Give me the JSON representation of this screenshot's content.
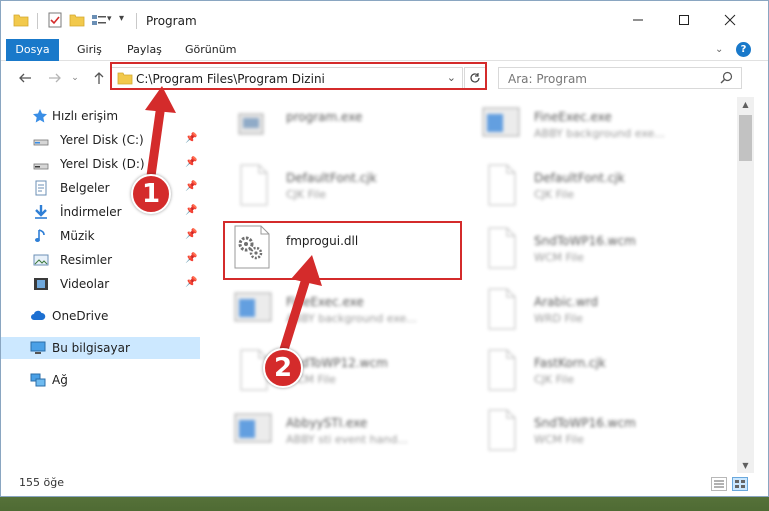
{
  "window": {
    "title": "Program",
    "controls": [
      "minimize",
      "maximize",
      "close"
    ]
  },
  "ribbon": {
    "tabs": [
      "Dosya",
      "Giriş",
      "Paylaş",
      "Görünüm"
    ],
    "accent": "#1979ca"
  },
  "address": {
    "path": "C:\\Program Files\\Program Dizini",
    "search_placeholder": "Ara: Program"
  },
  "sidebar": {
    "quick_access": "Hızlı erişim",
    "items": [
      {
        "label": "Yerel Disk (C:)",
        "icon": "drive-icon",
        "pinned": true
      },
      {
        "label": "Yerel Disk (D:)",
        "icon": "drive-icon",
        "pinned": true
      },
      {
        "label": "Belgeler",
        "icon": "documents-icon",
        "pinned": true
      },
      {
        "label": "İndirmeler",
        "icon": "downloads-icon",
        "pinned": true
      },
      {
        "label": "Müzik",
        "icon": "music-icon",
        "pinned": true
      },
      {
        "label": "Resimler",
        "icon": "pictures-icon",
        "pinned": true
      },
      {
        "label": "Videolar",
        "icon": "videos-icon",
        "pinned": true
      }
    ],
    "onedrive": "OneDrive",
    "this_pc": "Bu bilgisayar",
    "network": "Ağ"
  },
  "files": [
    {
      "name": "program.exe",
      "desc": "",
      "icon": "exe-icon",
      "blurred": true
    },
    {
      "name": "FineExec.exe",
      "desc": "ABBY background exe...",
      "icon": "app-window-icon",
      "blurred": true
    },
    {
      "name": "DefaultFont.cjk",
      "desc": "CJK File",
      "icon": "file-icon",
      "blurred": true
    },
    {
      "name": "DefaultFont.cjk",
      "desc": "CJK File",
      "icon": "file-icon",
      "blurred": true
    },
    {
      "name": "fmprogui.dll",
      "desc": "",
      "icon": "dll-gear-icon",
      "blurred": false
    },
    {
      "name": "SndToWP16.wcm",
      "desc": "WCM File",
      "icon": "file-icon",
      "blurred": true
    },
    {
      "name": "FineExec.exe",
      "desc": "ABBY background exe...",
      "icon": "app-window-icon",
      "blurred": true
    },
    {
      "name": "Arabic.wrd",
      "desc": "WRD File",
      "icon": "file-icon",
      "blurred": true
    },
    {
      "name": "SndToWP12.wcm",
      "desc": "WCM File",
      "icon": "file-icon",
      "blurred": true
    },
    {
      "name": "FastKorn.cjk",
      "desc": "CJK File",
      "icon": "file-icon",
      "blurred": true
    },
    {
      "name": "AbbyySTI.exe",
      "desc": "ABBY sti event hand...",
      "icon": "app-window-icon",
      "blurred": true
    },
    {
      "name": "SndToWP16.wcm",
      "desc": "WCM File",
      "icon": "file-icon",
      "blurred": true
    }
  ],
  "status": {
    "item_count": "155 öğe"
  },
  "annotations": {
    "step1": "1",
    "step2": "2",
    "color": "#d42b2b"
  }
}
